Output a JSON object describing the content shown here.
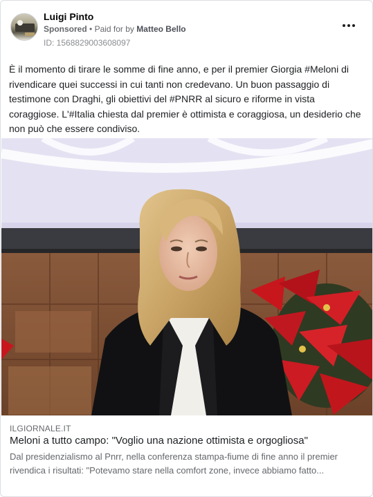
{
  "post": {
    "author": "Luigi Pinto",
    "sponsored_label": "Sponsored",
    "separator": "•",
    "paid_for_prefix": "Paid for by",
    "paid_for_name": "Matteo Bello",
    "ad_id": "ID: 1568829003608097",
    "body": "È il momento di tirare le somme di fine anno, e per il premier Giorgia #Meloni di rivendicare quei successi in cui tanti non credevano. Un buon passaggio di testimone con Draghi, gli obiettivi del #PNRR al sicuro e riforme in vista coraggiose. L'#Italia chiesta dal premier è ottimista e coraggiosa, un desiderio che non può che essere condiviso.",
    "more_icon": "more-horizontal-icon"
  },
  "link_preview": {
    "domain": "ILGIORNALE.IT",
    "title": "Meloni a tutto campo: \"Voglio una nazione ottimista e orgogliosa\"",
    "description": "Dal presidenzialismo al Pnrr, nella conferenza stampa-fiume di fine anno il premier rivendica i risultati: \"Potevamo stare nella comfort zone, invece abbiamo fatto..."
  },
  "colors": {
    "text_primary": "#1c1e21",
    "text_secondary": "#65676b",
    "poinsettia_red": "#c8161d",
    "backdrop_lavender": "#e4e2f2"
  }
}
